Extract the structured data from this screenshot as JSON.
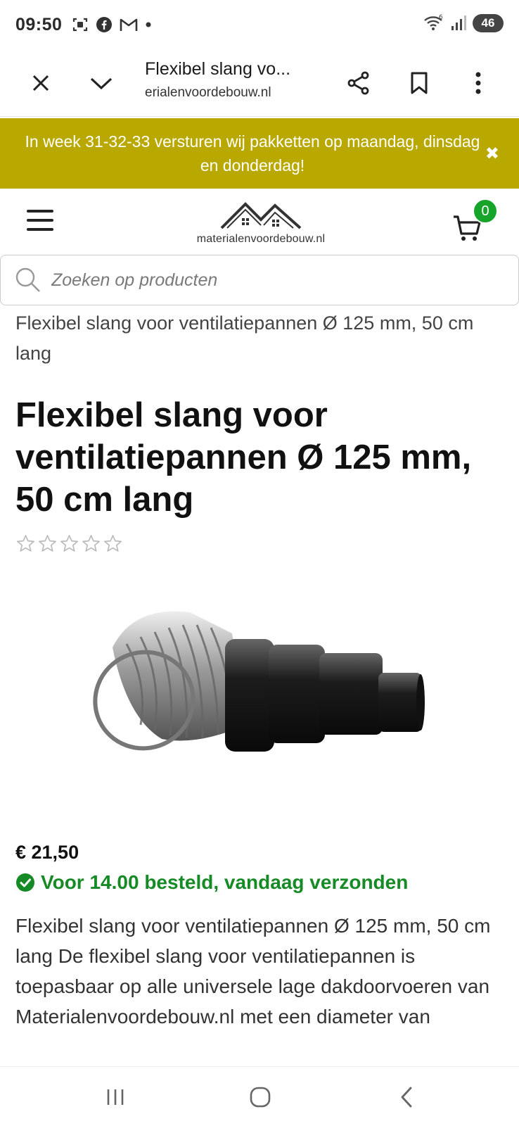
{
  "status_bar": {
    "time": "09:50",
    "left_icons": [
      "screenshot-icon",
      "facebook-icon",
      "gmail-icon",
      "dot-icon"
    ],
    "right_icons": [
      "wifi-icon",
      "signal-icon"
    ],
    "battery": "46"
  },
  "browser": {
    "tab_title": "Flexibel slang vo...",
    "url": "erialenvoordebouw.nl",
    "icons": [
      "close-icon",
      "chevron-down-icon",
      "share-icon",
      "bookmark-icon",
      "more-vert-icon"
    ]
  },
  "announcement": {
    "text": "In week 31-32-33 versturen wij pakketten op maandag, dinsdag en donderdag!",
    "close": "✖",
    "bg_color": "#b9a800"
  },
  "header": {
    "logo_text": "materialenvoordebouw.nl",
    "cart_count": "0",
    "badge_color": "#16a52a"
  },
  "search": {
    "placeholder": "Zoeken op producten"
  },
  "product": {
    "breadcrumb": "Flexibel slang voor ventilatiepannen Ø 125 mm, 50 cm lang",
    "title": "Flexibel slang voor ventilatiepannen Ø 125 mm, 50 cm lang",
    "rating": 0,
    "rating_max": 5,
    "price": "€ 21,50",
    "shipping_notice": "Voor 14.00 besteld, vandaag verzonden",
    "shipping_color": "#168a25",
    "description": "Flexibel slang voor ventilatiepannen Ø 125 mm, 50 cm lang De flexibel slang voor ventilatiepannen is toepasbaar op alle universele lage dakdoorvoeren van Materialenvoordebouw.nl met een diameter van"
  },
  "nav": {
    "icons": [
      "recent-apps-icon",
      "home-icon",
      "back-icon"
    ]
  }
}
